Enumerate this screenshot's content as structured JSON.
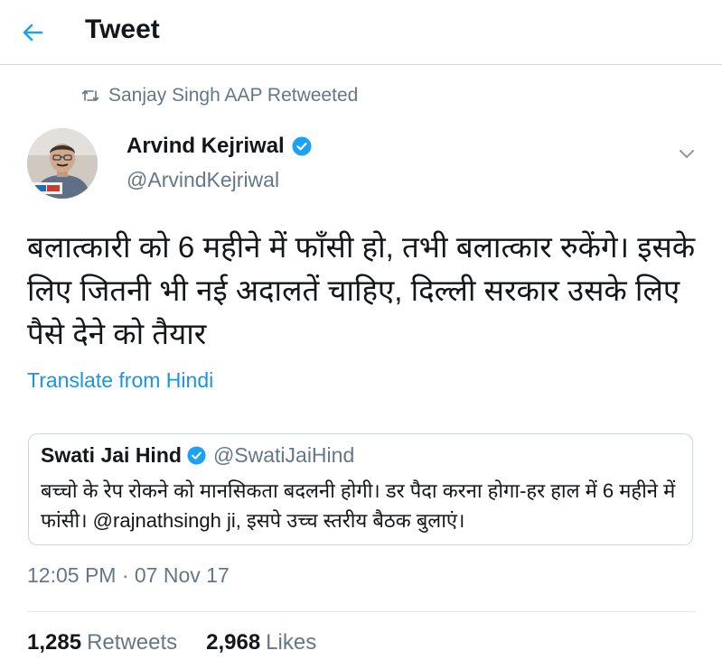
{
  "header": {
    "title": "Tweet",
    "back_icon": "arrow-left-icon"
  },
  "retweet": {
    "text": "Sanjay Singh AAP Retweeted",
    "icon": "retweet-icon"
  },
  "author": {
    "name": "Arvind Kejriwal",
    "handle": "@ArvindKejriwal",
    "verified": true
  },
  "tweet": {
    "text": "बलात्कारी को 6 महीने में फाँसी हो, तभी बलात्कार रुकेंगे। इसके लिए जितनी भी नई अदालतें चाहिए, दिल्ली सरकार उसके लिए पैसे देने को तैयार",
    "translate_label": "Translate from Hindi"
  },
  "quoted_tweet": {
    "name": "Swati Jai Hind",
    "handle": "@SwatiJaiHind",
    "verified": true,
    "text": "बच्चो के रेप रोकने को मानसिकता बदलनी होगी। डर पैदा करना होगा-हर हाल में 6 महीने में फांसी। @rajnathsingh ji, इसपे उच्च स्तरीय बैठक बुलाएं।"
  },
  "meta": {
    "timestamp": "12:05 PM · 07 Nov 17"
  },
  "stats": {
    "retweets_count": "1,285",
    "retweets_label": "Retweets",
    "likes_count": "2,968",
    "likes_label": "Likes"
  },
  "colors": {
    "accent": "#1da1f2",
    "link": "#1b95e0",
    "secondary_text": "#657786",
    "primary_text": "#14171a"
  }
}
